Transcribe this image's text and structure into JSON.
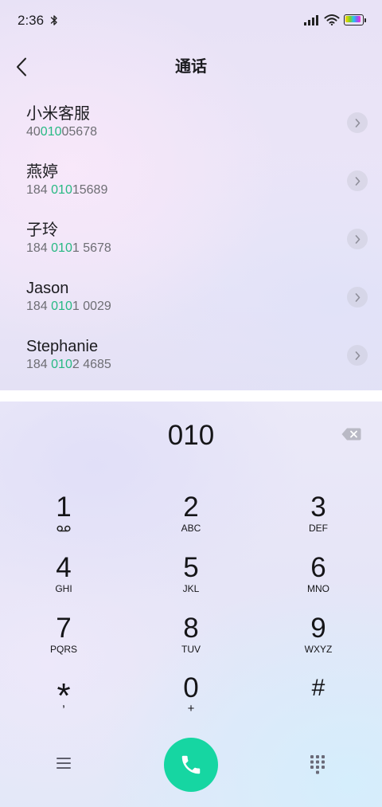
{
  "status_bar": {
    "time": "2:36",
    "icons": [
      "bluetooth-icon",
      "signal-icon",
      "wifi-icon",
      "battery-icon"
    ]
  },
  "header": {
    "back_icon": "chevron-left-icon",
    "title": "通话"
  },
  "contacts": [
    {
      "name": "小米客服",
      "number": {
        "before": "40",
        "match": "010",
        "after": "05678"
      }
    },
    {
      "name": "燕婷",
      "number": {
        "before": "184 ",
        "match": "010",
        "after": "15689"
      }
    },
    {
      "name": "子玲",
      "number": {
        "before": "184 ",
        "match": "010",
        "after": "1 5678"
      }
    },
    {
      "name": "Jason",
      "number": {
        "before": "184 ",
        "match": "010",
        "after": "1 0029"
      }
    },
    {
      "name": "Stephanie",
      "number": {
        "before": "184 ",
        "match": "010",
        "after": "2 4685"
      }
    }
  ],
  "contact_action_icon": "chevron-right-icon",
  "dialer": {
    "entered_number": "010",
    "backspace_icon": "backspace-icon"
  },
  "keypad": {
    "keys": [
      {
        "digit": "1",
        "icon": "voicemail-icon"
      },
      {
        "digit": "2",
        "sub": "ABC"
      },
      {
        "digit": "3",
        "sub": "DEF"
      },
      {
        "digit": "4",
        "sub": "GHI"
      },
      {
        "digit": "5",
        "sub": "JKL"
      },
      {
        "digit": "6",
        "sub": "MNO"
      },
      {
        "digit": "7",
        "sub": "PQRS"
      },
      {
        "digit": "8",
        "sub": "TUV"
      },
      {
        "digit": "9",
        "sub": "WXYZ"
      },
      {
        "digit": "*",
        "sub": ","
      },
      {
        "digit": "0",
        "sub": "+"
      },
      {
        "digit": "#"
      }
    ]
  },
  "bottom_bar": {
    "menu_icon": "menu-icon",
    "call_icon": "phone-icon",
    "dialpad_icon": "dialpad-icon"
  },
  "colors": {
    "match_highlight": "#27b983",
    "call_button": "#16d6a2"
  }
}
